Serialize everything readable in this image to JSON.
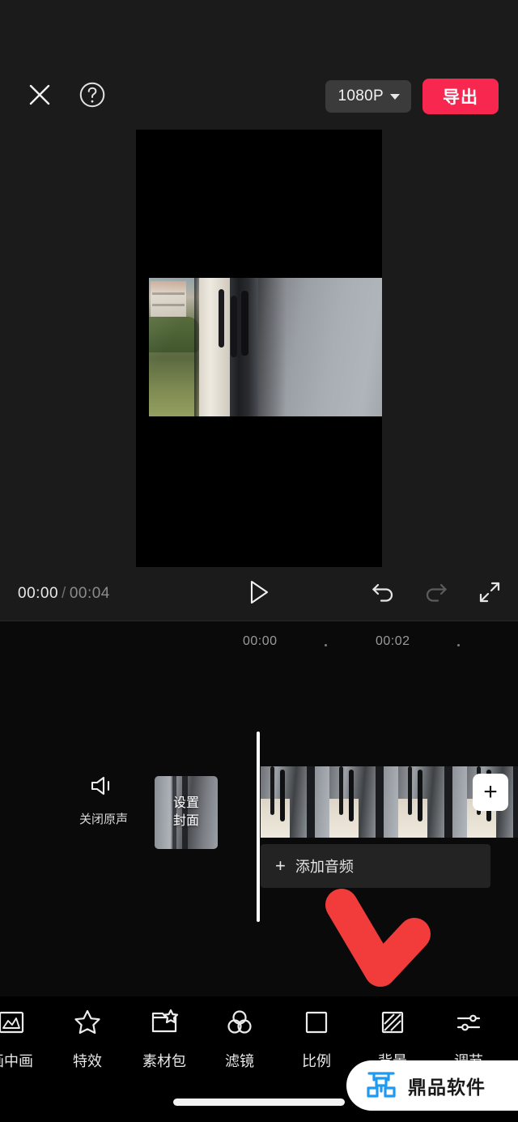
{
  "app": {
    "name": "video-editor"
  },
  "topbar": {
    "close_icon": "close-icon",
    "help_icon": "question-mark-icon",
    "resolution": "1080P",
    "export_label": "导出",
    "accent_red": "#f7274f"
  },
  "player": {
    "current_time": "00:00",
    "separator": "/",
    "total_time": "00:04",
    "play_icon": "play-icon",
    "undo_icon": "undo-icon",
    "redo_icon": "redo-icon",
    "fullscreen_icon": "fullscreen-icon"
  },
  "timeline": {
    "ruler_ticks": [
      "00:00",
      "00:02"
    ],
    "mute": {
      "icon": "speaker-mute-icon",
      "label": "关闭原声"
    },
    "cover": {
      "line1": "设置",
      "line2": "封面"
    },
    "add_clip_label": "+",
    "audio": {
      "plus": "+",
      "label": "添加音频"
    }
  },
  "toolbar": {
    "items": [
      {
        "label": "画中画",
        "icon": "picture-in-picture-icon"
      },
      {
        "label": "特效",
        "icon": "star-sparkle-icon"
      },
      {
        "label": "素材包",
        "icon": "material-package-icon"
      },
      {
        "label": "滤镜",
        "icon": "filter-circles-icon"
      },
      {
        "label": "比例",
        "icon": "aspect-ratio-square-icon"
      },
      {
        "label": "背景",
        "icon": "background-hatched-icon"
      },
      {
        "label": "调节",
        "icon": "adjust-sliders-icon"
      }
    ]
  },
  "annotation": {
    "arrow": "red-arrow-pointing-down-right",
    "color": "#f23b3b"
  },
  "watermark": {
    "text": "鼎品软件",
    "logo": "dingpin-logo-icon",
    "logo_color": "#1e9bf0"
  }
}
